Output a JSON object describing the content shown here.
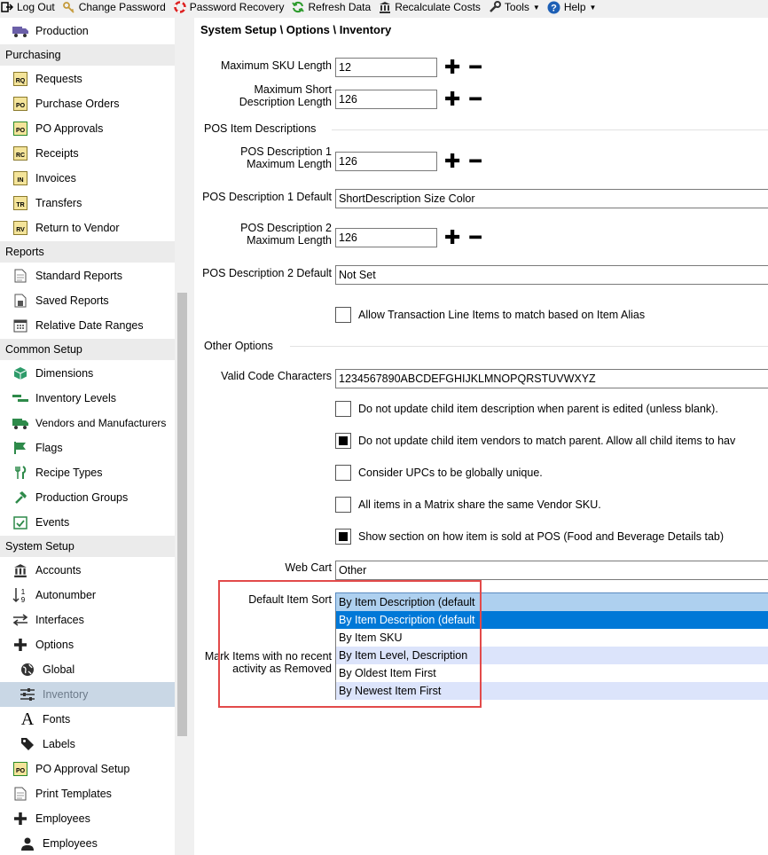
{
  "toolbar": {
    "items": [
      {
        "label": "Log Out",
        "icon": "logout-icon"
      },
      {
        "label": "Change Password",
        "icon": "key-icon"
      },
      {
        "label": "Password Recovery",
        "icon": "lifebuoy-icon"
      },
      {
        "label": "Refresh Data",
        "icon": "refresh-icon"
      },
      {
        "label": "Recalculate Costs",
        "icon": "bank-icon"
      },
      {
        "label": "Tools",
        "icon": "wrench-icon"
      },
      {
        "label": "Help",
        "icon": "help-icon"
      }
    ]
  },
  "sidebar": {
    "production": "Production",
    "purchasing": {
      "header": "Purchasing",
      "items": [
        {
          "label": "Requests",
          "badge": "RQ"
        },
        {
          "label": "Purchase Orders",
          "badge": "PO"
        },
        {
          "label": "PO Approvals",
          "badge": "PO"
        },
        {
          "label": "Receipts",
          "badge": "RC"
        },
        {
          "label": "Invoices",
          "badge": "IN"
        },
        {
          "label": "Transfers",
          "badge": "TR"
        },
        {
          "label": "Return to Vendor",
          "badge": "RV"
        }
      ]
    },
    "reports": {
      "header": "Reports",
      "items": [
        "Standard Reports",
        "Saved Reports",
        "Relative Date Ranges"
      ]
    },
    "common_setup": {
      "header": "Common Setup",
      "items": [
        "Dimensions",
        "Inventory Levels",
        "Vendors and Manufacturers",
        "Flags",
        "Recipe Types",
        "Production Groups",
        "Events"
      ]
    },
    "system_setup": {
      "header": "System Setup",
      "items": [
        "Accounts",
        "Autonumber",
        "Interfaces",
        "Options"
      ],
      "options_children": [
        "Global",
        "Inventory"
      ],
      "after": [
        "Fonts",
        "Labels",
        "PO Approval Setup",
        "Print Templates",
        "Employees",
        "Employees"
      ],
      "po_badge": "PO"
    }
  },
  "main": {
    "breadcrumb": "System Setup \\ Options \\ Inventory",
    "max_sku_label": "Maximum SKU Length",
    "max_sku_value": "12",
    "max_short_label_1": "Maximum Short",
    "max_short_label_2": "Description Length",
    "max_short_value": "126",
    "pos_section": "POS Item Descriptions",
    "pos1_label_1": "POS Description 1",
    "pos1_label_2": "Maximum Length",
    "pos1_value": "126",
    "pos1_default_label": "POS Description 1 Default",
    "pos1_default_value": "ShortDescription Size Color",
    "pos2_label_1": "POS Description 2",
    "pos2_label_2": "Maximum Length",
    "pos2_value": "126",
    "pos2_default_label": "POS Description 2 Default",
    "pos2_default_value": "Not Set",
    "alias_checkbox": "Allow Transaction Line Items to match based on Item Alias",
    "other_section": "Other Options",
    "valid_chars_label": "Valid Code Characters",
    "valid_chars_value": "1234567890ABCDEFGHIJKLMNOPQRSTUVWXYZ",
    "checkboxes": [
      {
        "label": "Do not update child item description when parent is edited (unless blank).",
        "checked": false
      },
      {
        "label": "Do not update child item vendors to match parent.  Allow all child items to hav",
        "checked": true
      },
      {
        "label": "Consider UPCs to be globally unique.",
        "checked": false
      },
      {
        "label": "All items in a Matrix share the same Vendor SKU.",
        "checked": false
      },
      {
        "label": "Show section on how item is sold at POS (Food and Beverage Details tab)",
        "checked": true
      }
    ],
    "web_cart_label": "Web Cart",
    "web_cart_value": "Other",
    "default_sort_label": "Default Item Sort",
    "default_sort_value": "By Item Description (default",
    "mark_items_label_1": "Mark Items with no recent",
    "mark_items_label_2": "activity as Removed",
    "sort_options": [
      "By Item Description (default",
      "By Item SKU",
      "By Item Level, Description",
      "By Oldest Item First",
      "By Newest Item First"
    ],
    "plus": "✚",
    "minus": "━"
  },
  "colors": {
    "selected_option_bg": "#0078d7",
    "alt_row_bg": "#dce4fb",
    "combo_bg": "#aed0ef",
    "highlight_border": "#e24a4a",
    "sidebar_selected_bg": "#c9d7e5"
  }
}
